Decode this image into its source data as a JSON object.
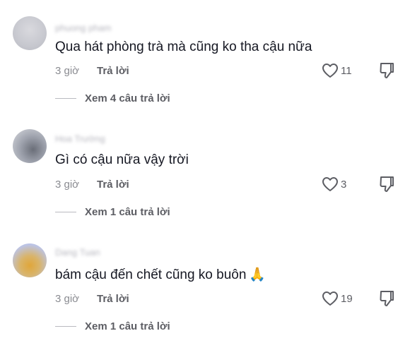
{
  "comments": [
    {
      "username": "phuong pham",
      "text": "Qua hát phòng trà mà cũng ko tha cậu nữa",
      "time": "3 giờ",
      "reply_label": "Trả lời",
      "likes": "11",
      "view_replies": "Xem 4 câu trả lời",
      "avatar": "blurred-avatar"
    },
    {
      "username": "Hoa Trường",
      "text": "Gì có cậu nữa vậy trời",
      "time": "3 giờ",
      "reply_label": "Trả lời",
      "likes": "3",
      "view_replies": "Xem 1 câu trả lời",
      "avatar": "blurred-avatar"
    },
    {
      "username": "Dang Tuan",
      "text": "bám cậu đến chết cũng ko buôn",
      "emoji": "🙏",
      "time": "3 giờ",
      "reply_label": "Trả lời",
      "likes": "19",
      "view_replies": "Xem 1 câu trả lời",
      "avatar": "blurred-avatar"
    }
  ],
  "icons": {
    "like": "heart-icon",
    "dislike": "thumbs-down-icon"
  },
  "colors": {
    "text": "#161823",
    "meta": "#8a8b91",
    "action": "#5c5d63"
  }
}
